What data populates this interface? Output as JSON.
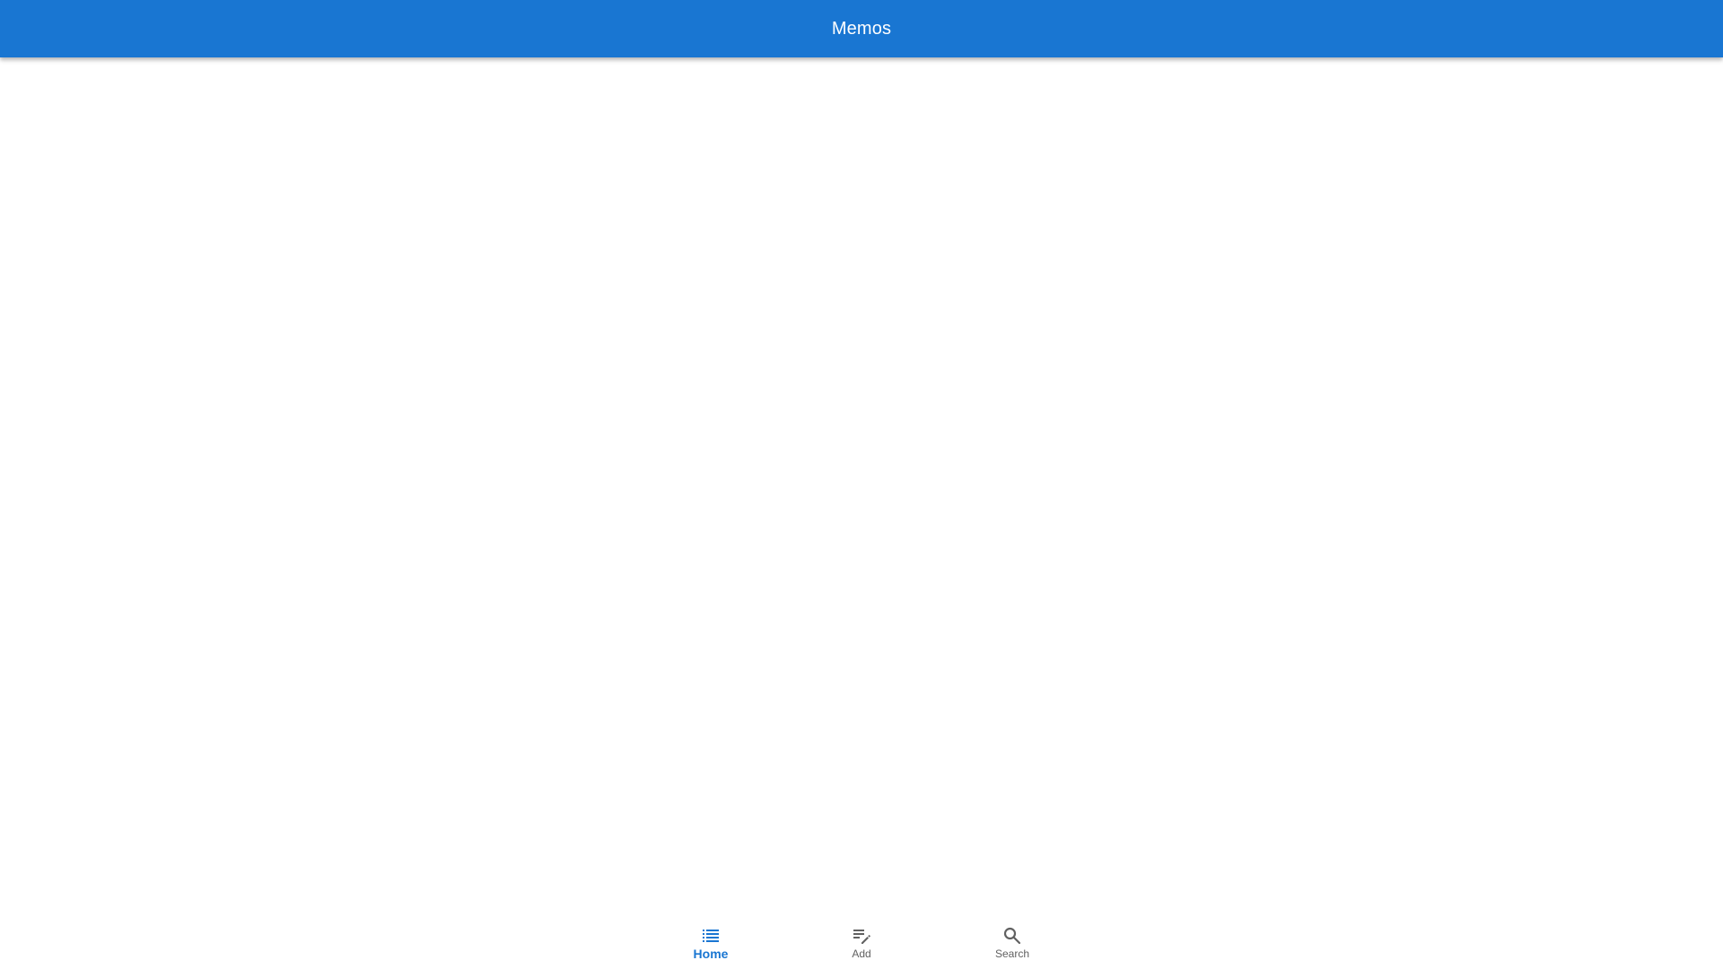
{
  "app_bar": {
    "title": "Memos",
    "color": "#1976d2"
  },
  "bottom_nav": {
    "active_color": "#1976d2",
    "inactive_color": "#616161",
    "items": [
      {
        "label": "Home",
        "icon": "list-icon",
        "active": true
      },
      {
        "label": "Add",
        "icon": "edit-note-icon",
        "active": false
      },
      {
        "label": "Search",
        "icon": "search-icon",
        "active": false
      }
    ]
  }
}
